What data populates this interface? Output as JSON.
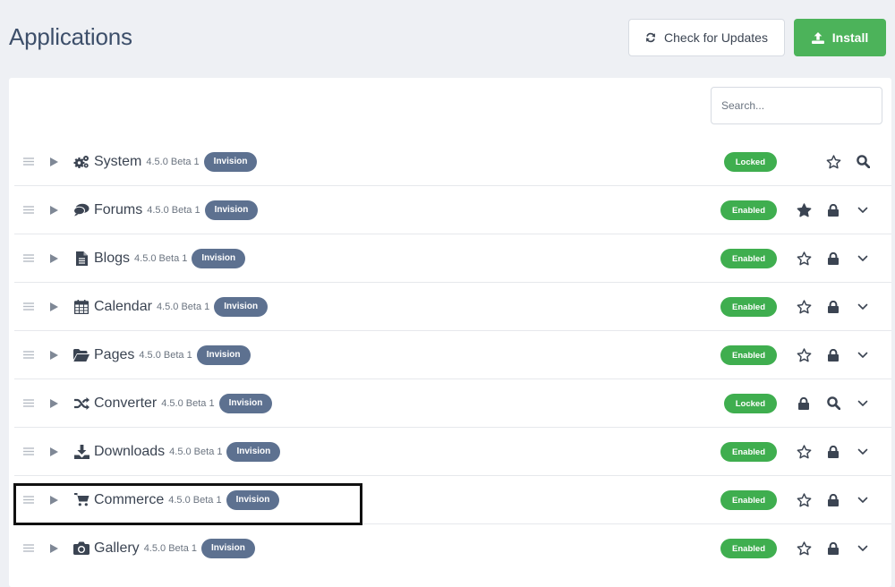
{
  "header": {
    "title": "Applications",
    "check_updates_label": "Check for Updates",
    "install_label": "Install"
  },
  "search": {
    "placeholder": "Search..."
  },
  "apps": [
    {
      "name": "System",
      "version": "4.5.0 Beta 1",
      "developer": "Invision",
      "status": "Locked",
      "icon": "cogs-icon",
      "actions": [
        "star-outline-icon",
        "search-icon"
      ]
    },
    {
      "name": "Forums",
      "version": "4.5.0 Beta 1",
      "developer": "Invision",
      "status": "Enabled",
      "icon": "comments-icon",
      "actions": [
        "star-filled-icon",
        "lock-icon",
        "chevron-down-icon"
      ]
    },
    {
      "name": "Blogs",
      "version": "4.5.0 Beta 1",
      "developer": "Invision",
      "status": "Enabled",
      "icon": "file-icon",
      "actions": [
        "star-outline-icon",
        "lock-icon",
        "chevron-down-icon"
      ]
    },
    {
      "name": "Calendar",
      "version": "4.5.0 Beta 1",
      "developer": "Invision",
      "status": "Enabled",
      "icon": "calendar-icon",
      "actions": [
        "star-outline-icon",
        "lock-icon",
        "chevron-down-icon"
      ]
    },
    {
      "name": "Pages",
      "version": "4.5.0 Beta 1",
      "developer": "Invision",
      "status": "Enabled",
      "icon": "folder-open-icon",
      "actions": [
        "star-outline-icon",
        "lock-icon",
        "chevron-down-icon"
      ]
    },
    {
      "name": "Converter",
      "version": "4.5.0 Beta 1",
      "developer": "Invision",
      "status": "Locked",
      "icon": "shuffle-icon",
      "actions": [
        "lock-icon",
        "search-icon",
        "chevron-down-icon"
      ]
    },
    {
      "name": "Downloads",
      "version": "4.5.0 Beta 1",
      "developer": "Invision",
      "status": "Enabled",
      "icon": "download-icon",
      "actions": [
        "star-outline-icon",
        "lock-icon",
        "chevron-down-icon"
      ]
    },
    {
      "name": "Commerce",
      "version": "4.5.0 Beta 1",
      "developer": "Invision",
      "status": "Enabled",
      "icon": "shopping-cart-icon",
      "actions": [
        "star-outline-icon",
        "lock-icon",
        "chevron-down-icon"
      ]
    },
    {
      "name": "Gallery",
      "version": "4.5.0 Beta 1",
      "developer": "Invision",
      "status": "Enabled",
      "icon": "camera-icon",
      "actions": [
        "star-outline-icon",
        "lock-icon",
        "chevron-down-icon"
      ]
    }
  ],
  "colors": {
    "enabled": "#3fae4f",
    "developer_badge": "#5d7190",
    "install": "#4cb35a",
    "title": "#3d4f6a"
  }
}
